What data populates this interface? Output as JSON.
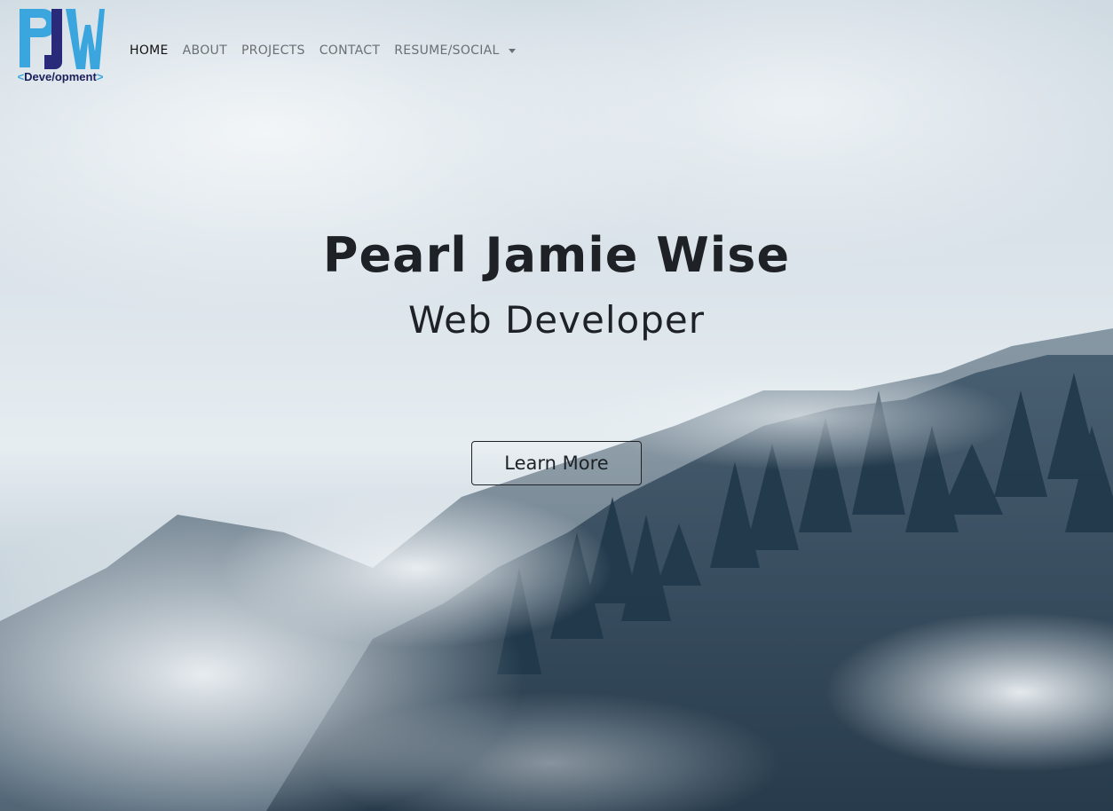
{
  "brand": {
    "logo_text": "PJW",
    "logo_sub": "Deve/opment",
    "colors": {
      "light_blue": "#3aa6dd",
      "navy": "#2a2a7a"
    }
  },
  "nav": {
    "items": [
      {
        "label": "HOME",
        "active": true
      },
      {
        "label": "ABOUT",
        "active": false
      },
      {
        "label": "PROJECTS",
        "active": false
      },
      {
        "label": "CONTACT",
        "active": false
      },
      {
        "label": "RESUME/SOCIAL",
        "active": false,
        "dropdown": true
      }
    ]
  },
  "hero": {
    "title": "Pearl Jamie Wise",
    "subtitle": "Web Developer",
    "button_label": "Learn More",
    "background": "misty-forest-photo"
  }
}
